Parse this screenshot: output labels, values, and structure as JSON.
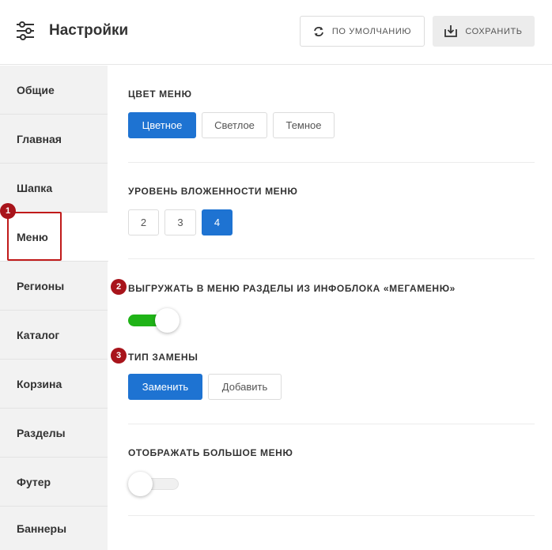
{
  "header": {
    "title": "Настройки",
    "title_icon": "sliders-icon",
    "reset_label": "ПО УМОЛЧАНИЮ",
    "reset_icon": "refresh-icon",
    "save_label": "СОХРАНИТЬ",
    "save_icon": "download-icon"
  },
  "sidebar": {
    "items": [
      {
        "label": "Общие"
      },
      {
        "label": "Главная"
      },
      {
        "label": "Шапка"
      },
      {
        "label": "Меню"
      },
      {
        "label": "Регионы"
      },
      {
        "label": "Каталог"
      },
      {
        "label": "Корзина"
      },
      {
        "label": "Разделы"
      },
      {
        "label": "Футер"
      },
      {
        "label": "Баннеры"
      }
    ],
    "active": "Меню"
  },
  "sections": {
    "menu_color": {
      "label": "ЦВЕТ МЕНЮ",
      "options": [
        "Цветное",
        "Светлое",
        "Темное"
      ],
      "selected": "Цветное"
    },
    "nesting": {
      "label": "УРОВЕНЬ ВЛОЖЕННОСТИ МЕНЮ",
      "options": [
        "2",
        "3",
        "4"
      ],
      "selected": "4"
    },
    "megamenu": {
      "label": "ВЫГРУЖАТЬ В МЕНЮ РАЗДЕЛЫ ИЗ ИНФОБЛОКА «МЕГАМЕНЮ»",
      "enabled": true
    },
    "replace_type": {
      "label": "ТИП ЗАМЕНЫ",
      "options": [
        "Заменить",
        "Добавить"
      ],
      "selected": "Заменить"
    },
    "big_menu": {
      "label": "ОТОБРАЖАТЬ БОЛЬШОЕ МЕНЮ",
      "enabled": false
    }
  },
  "annotations": {
    "badge1": "1",
    "badge2": "2",
    "badge3": "3"
  },
  "colors": {
    "accent": "#1e73d2",
    "toggle_on": "#1fb317",
    "badge": "#a8141b",
    "highlight": "#c01a1a"
  }
}
